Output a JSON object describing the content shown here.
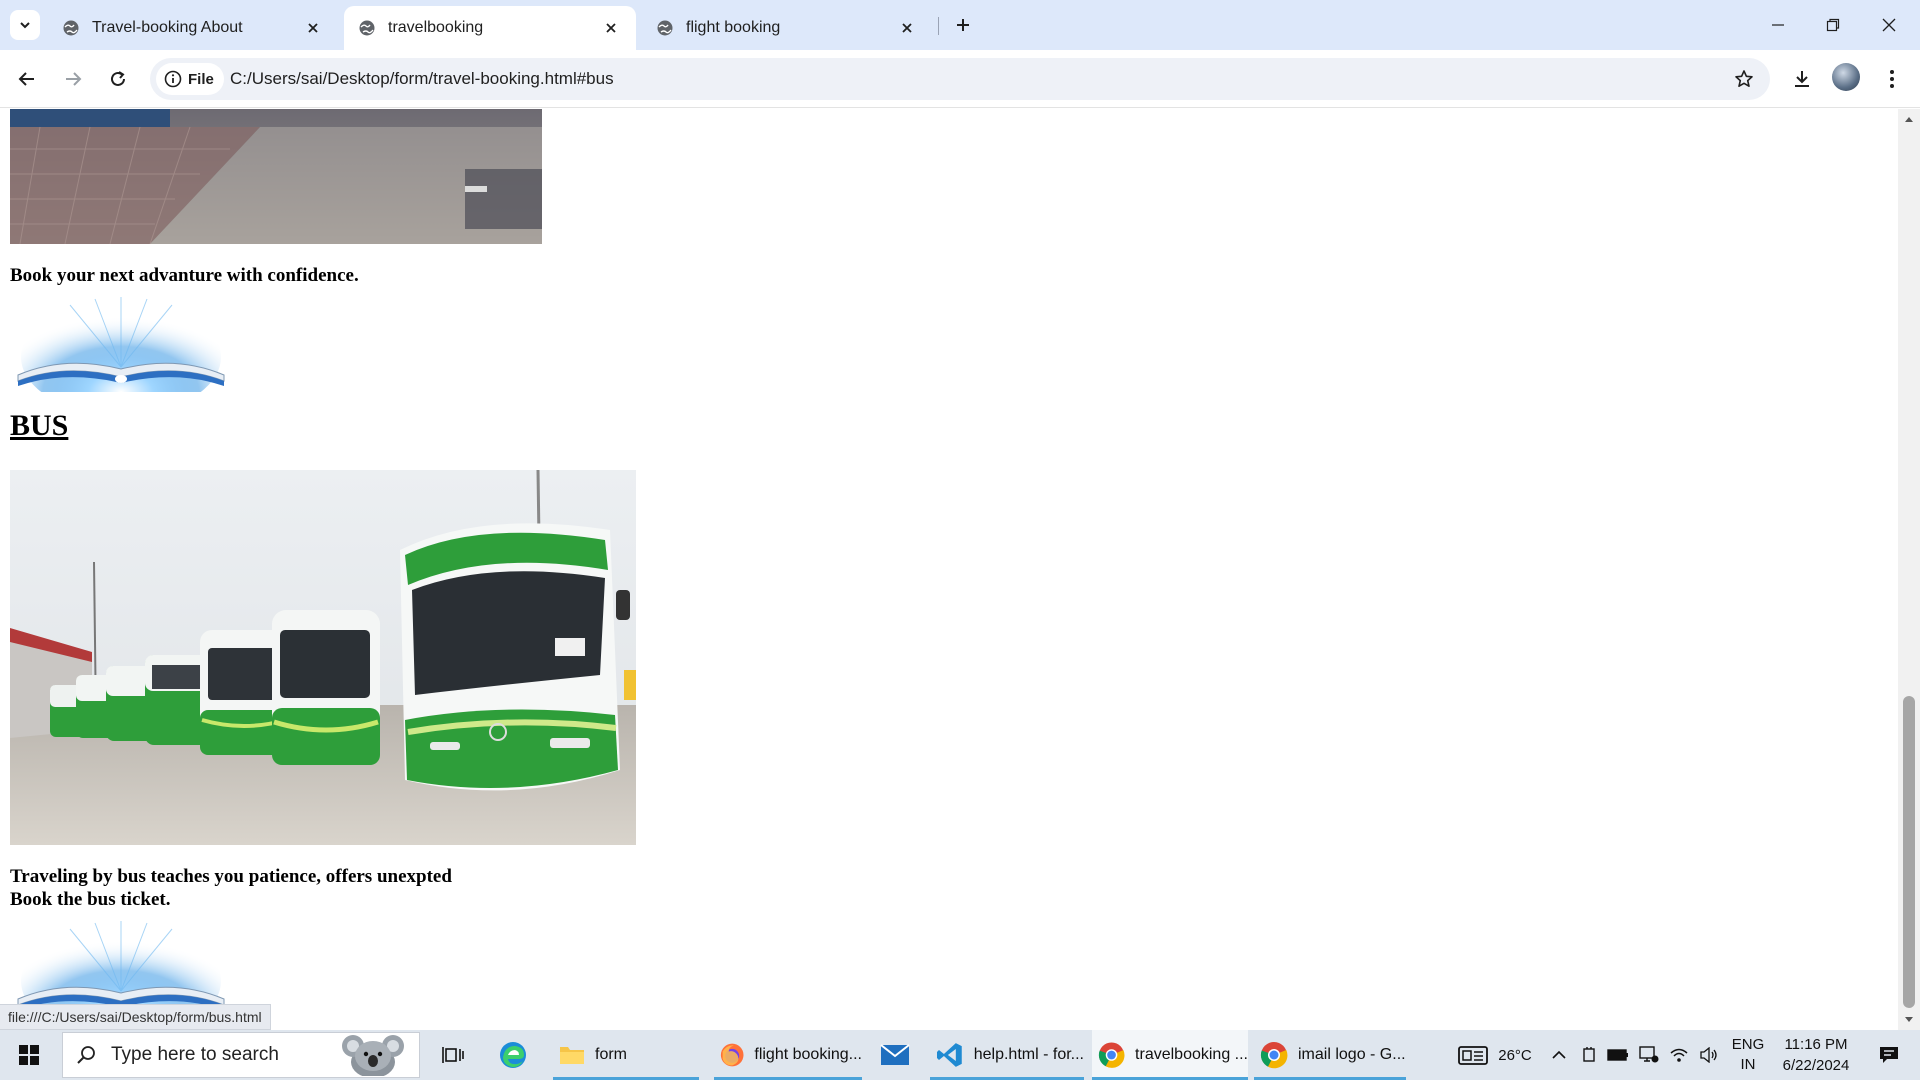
{
  "browser": {
    "tabs": [
      {
        "title": "Travel-booking About",
        "active": false
      },
      {
        "title": "travelbooking",
        "active": true
      },
      {
        "title": "flight booking",
        "active": false
      }
    ],
    "site_chip_label": "File",
    "url": "C:/Users/sai/Desktop/form/travel-booking.html#bus"
  },
  "page": {
    "tagline": "Book your next advanture with confidence.",
    "bus_heading": "BUS",
    "bus_description_line1": "Traveling by bus teaches you patience, offers unexpted",
    "bus_description_line2": "Book the bus ticket.",
    "status_bar_url": "file:///C:/Users/sai/Desktop/form/bus.html"
  },
  "scrollbar": {
    "position_fraction": 0.65
  },
  "taskbar": {
    "search_placeholder": "Type here to search",
    "apps": [
      {
        "name": "task-view",
        "label": ""
      },
      {
        "name": "edge",
        "label": ""
      },
      {
        "name": "file-explorer",
        "label": "form"
      },
      {
        "name": "firefox",
        "label": "flight booking..."
      },
      {
        "name": "mail",
        "label": ""
      },
      {
        "name": "vscode",
        "label": "help.html - for..."
      },
      {
        "name": "chrome-travelbooking",
        "label": "travelbooking ..."
      },
      {
        "name": "chrome-imail",
        "label": "imail logo - G..."
      }
    ],
    "weather": "26°C",
    "language_line1": "ENG",
    "language_line2": "IN",
    "time": "11:16 PM",
    "date": "6/22/2024"
  },
  "colors": {
    "tabstrip_bg": "#dde8fa",
    "taskbar_bg": "#dfe6ee",
    "taskbar_active_underline": "#4aa3d9",
    "bus_green": "#2e9e3a"
  }
}
